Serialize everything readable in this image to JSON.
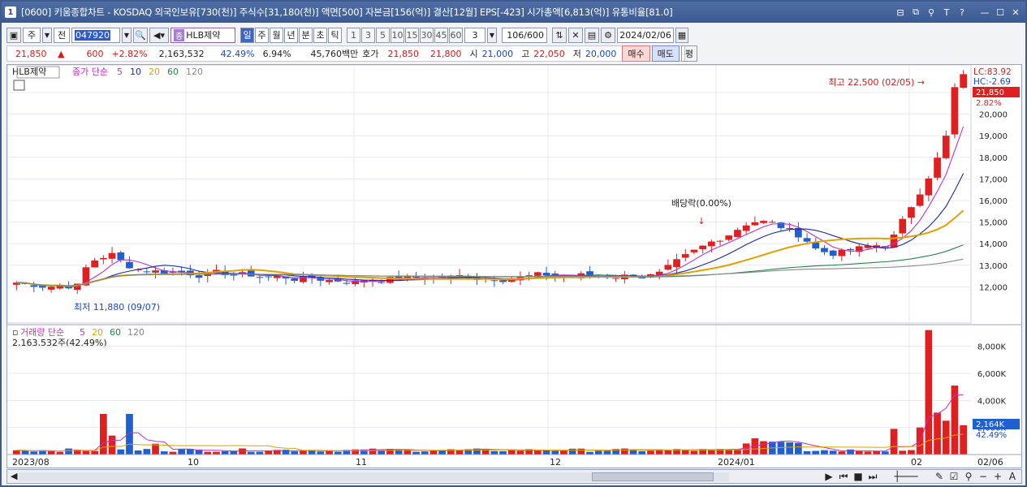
{
  "title": {
    "num": "1",
    "text": "[0600] 키움종합차트 - KOSDAQ 외국인보유[730(천)] 주식수[31,180(천)] 액면[500] 자본금[156(억)] 결산[12월] EPS[-423] 시가총액[6,813(억)] 유통비율[81.0]",
    "buttons": [
      "⊟",
      "⧉",
      "⚲",
      "T",
      "?",
      "—",
      "☐",
      "✕"
    ]
  },
  "toolbar": {
    "market": "주",
    "all": "전",
    "code": "047920",
    "name_tag": "종",
    "name": "HLB제약",
    "periods": [
      "일",
      "주",
      "월",
      "년",
      "분",
      "초",
      "틱"
    ],
    "active_period": "일",
    "intervals": [
      "1",
      "3",
      "5",
      "10",
      "15",
      "30",
      "45",
      "60"
    ],
    "interval_value": "3",
    "pages": "106/600",
    "date": "2024/02/06"
  },
  "quote": {
    "price": "21,850",
    "arrow": "▲",
    "change": "600",
    "change_pct": "+2.82%",
    "volume": "2,163,532",
    "vol_ratio": "42.49%",
    "turnover": "6.94%",
    "amount": "45,760백만",
    "hoga_label": "호가",
    "ask": "21,850",
    "bid": "21,800",
    "open_label": "시",
    "open": "21,000",
    "high_label": "고",
    "high": "22,050",
    "low_label": "저",
    "low": "20,000",
    "buy": "매수",
    "sell": "매도",
    "avg": "평"
  },
  "price_panel": {
    "label": "HLB제약",
    "ma_label": "종가 단순",
    "ma_periods": [
      "5",
      "10",
      "20",
      "60",
      "120"
    ],
    "ma_colors": [
      "#c030c0",
      "#1a2aa0",
      "#e0a000",
      "#228844",
      "#888888"
    ],
    "lc": "LC:83.92",
    "hc": "HC:-2.69",
    "last_price": "21,850",
    "last_pct": "2.82%",
    "high_note": "최고 22,500 (02/05) →",
    "low_note": "최저 11,880 (09/07)",
    "dividend_note": "배당락(0.00%)",
    "y_ticks": [
      "21,000",
      "20,000",
      "19,000",
      "18,000",
      "17,000",
      "16,000",
      "15,000",
      "14,000",
      "13,000",
      "12,000"
    ]
  },
  "volume_panel": {
    "label": "거래량 단순",
    "ma_periods": [
      "5",
      "20",
      "60",
      "120"
    ],
    "value_note": "2,163,532주(42.49%)",
    "y_ticks": [
      "8,000K",
      "6,000K",
      "4,000K",
      "2,000K"
    ],
    "last_vol": "2,164K",
    "last_pct": "42.49%"
  },
  "x_labels": [
    "2023/08",
    "10",
    "11",
    "12",
    "2024/01",
    "02",
    "02/06"
  ],
  "colors": {
    "up": "#e02020",
    "down": "#1f5fd0",
    "accent": "#3b5a91"
  }
}
